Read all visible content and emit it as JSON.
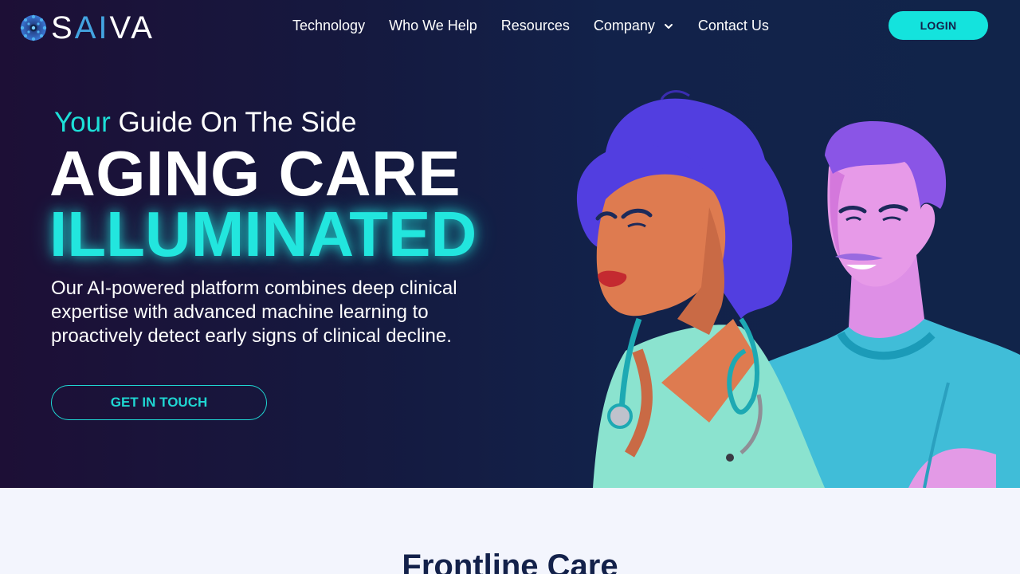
{
  "brand": {
    "logo_text_a": "S",
    "logo_text_b": "AI",
    "logo_text_c": "VA",
    "logo_icon": "saiva-mark-icon",
    "colors": {
      "accent": "#14e3dd",
      "navy": "#13214a",
      "logo_blue": "#43a4e0"
    }
  },
  "nav": {
    "items": [
      {
        "label": "Technology"
      },
      {
        "label": "Who We Help"
      },
      {
        "label": "Resources"
      },
      {
        "label": "Company",
        "icon": "chevron-down-icon"
      },
      {
        "label": "Contact Us"
      }
    ],
    "login_label": "LOGIN"
  },
  "hero": {
    "tagline_accent": "Your",
    "tagline_rest": " Guide On The Side",
    "headline_line1": "AGING CARE",
    "headline_line2": "ILLUMINATED",
    "description": "Our AI-powered platform combines deep clinical expertise with advanced machine learning to proactively detect early signs of clinical decline.",
    "cta_label": "GET IN TOUCH",
    "illustration": "healthcare-workers-illustration"
  },
  "next_section": {
    "title": "Frontline Care"
  }
}
